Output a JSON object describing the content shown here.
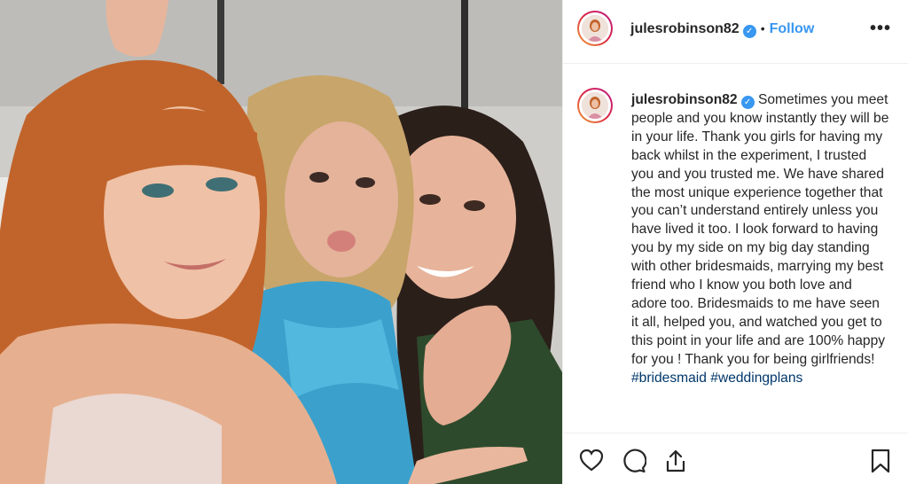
{
  "post": {
    "username": "julesrobinson82",
    "verified_mark": "✓",
    "separator": "•",
    "follow_label": "Follow",
    "more_label": "•••",
    "caption_text": "Sometimes you meet people and you know instantly they will be in your life. Thank you girls for having my back whilst in the experiment, I trusted you and you trusted me. We have shared the most unique experience together that you can’t understand entirely unless you have lived it too. I look forward to having you by my side on my big day standing with other bridesmaids, marrying my best friend who I know you both love and adore too. Bridesmaids to me have seen it all, helped you, and watched you get to this point in your life and are 100% happy for you ! Thank you for being girlfriends!",
    "hashtags": "#bridesmaid #weddingplans"
  },
  "icons": {
    "like": "heart-icon",
    "comment": "comment-icon",
    "share": "share-icon",
    "save": "bookmark-icon",
    "more": "more-options-icon"
  },
  "colors": {
    "link_blue": "#3897f0",
    "text": "#262626",
    "hashtag": "#00376b"
  }
}
